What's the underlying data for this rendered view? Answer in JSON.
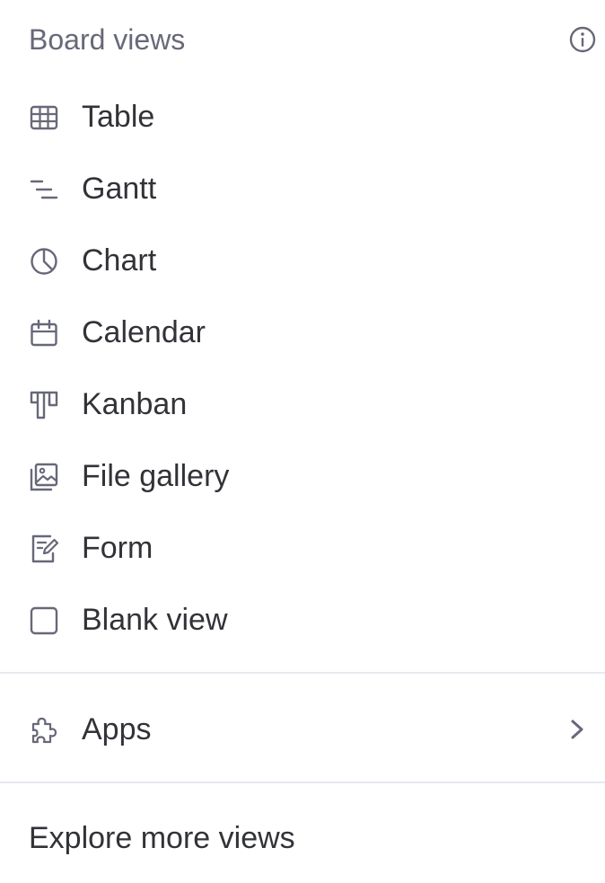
{
  "header": {
    "title": "Board views",
    "info_icon": "info-icon"
  },
  "views": [
    {
      "label": "Table",
      "icon": "table-icon"
    },
    {
      "label": "Gantt",
      "icon": "gantt-icon"
    },
    {
      "label": "Chart",
      "icon": "chart-pie-icon"
    },
    {
      "label": "Calendar",
      "icon": "calendar-icon"
    },
    {
      "label": "Kanban",
      "icon": "kanban-icon"
    },
    {
      "label": "File gallery",
      "icon": "image-gallery-icon"
    },
    {
      "label": "Form",
      "icon": "form-icon"
    },
    {
      "label": "Blank view",
      "icon": "blank-square-icon"
    }
  ],
  "apps": {
    "label": "Apps",
    "icon": "puzzle-icon",
    "arrow_icon": "chevron-right-icon"
  },
  "footer": {
    "explore_label": "Explore more views"
  },
  "colors": {
    "icon": "#676879",
    "text": "#323338",
    "muted_text": "#676879",
    "divider": "#e6e9ef",
    "background": "#ffffff"
  }
}
